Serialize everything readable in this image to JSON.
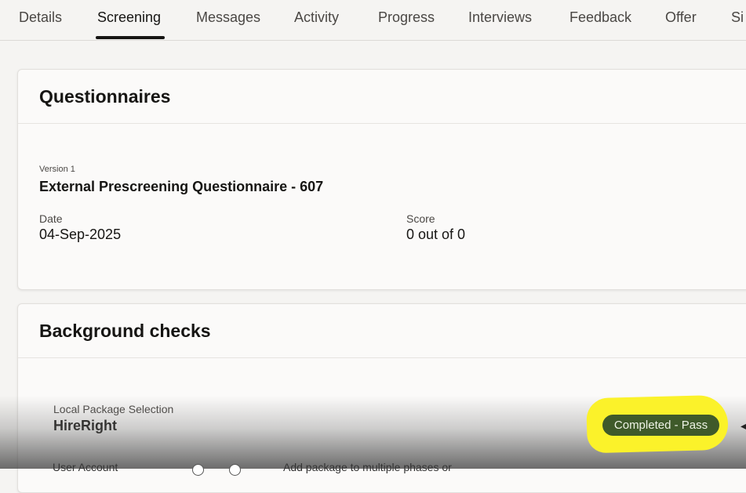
{
  "tabs": [
    {
      "label": "Details"
    },
    {
      "label": "Screening"
    },
    {
      "label": "Messages"
    },
    {
      "label": "Activity"
    },
    {
      "label": "Progress"
    },
    {
      "label": "Interviews"
    },
    {
      "label": "Feedback"
    },
    {
      "label": "Offer"
    },
    {
      "label": "Si"
    }
  ],
  "active_tab": "Screening",
  "questionnaires": {
    "title": "Questionnaires",
    "version": "Version 1",
    "name": "External Prescreening Questionnaire - 607",
    "date_label": "Date",
    "date_value": "04-Sep-2025",
    "score_label": "Score",
    "score_value": "0 out of 0"
  },
  "background_checks": {
    "title": "Background checks",
    "package_label": "Local Package Selection",
    "package_value": "HireRight",
    "status_badge": "Completed - Pass",
    "user_account_label": "User Account",
    "add_package_text": "Add package to multiple phases or"
  },
  "colors": {
    "background": "#f5f4f2",
    "badge_bg": "#3f5a2a",
    "highlight": "#fbf22a",
    "active_tab_underline": "#161513"
  }
}
